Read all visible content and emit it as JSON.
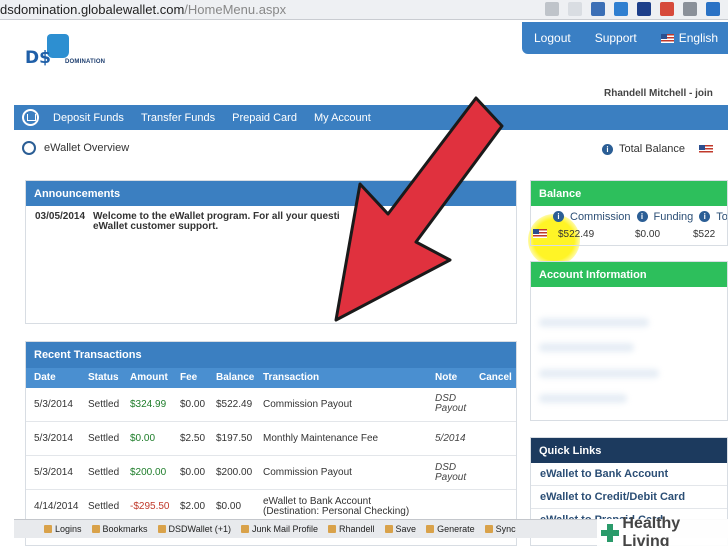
{
  "browser": {
    "url_domain": "dsdomination.globalewallet.com",
    "url_path": "/HomeMenu.aspx"
  },
  "brand": {
    "logo_text": "D$",
    "logo_sub": "DOMINATION"
  },
  "topnav": {
    "logout": "Logout",
    "support": "Support",
    "language": "English"
  },
  "user": {
    "name": "Rhandell Mitchell - join"
  },
  "mainnav": [
    "Deposit Funds",
    "Transfer Funds",
    "Prepaid Card",
    "My Account"
  ],
  "subheader": {
    "title": "eWallet Overview",
    "total_balance_label": "Total Balance"
  },
  "announcements": {
    "title": "Announcements",
    "items": [
      {
        "date": "03/05/2014",
        "text_line1": "Welcome to the eWallet program. For all your questi",
        "text_line2": "eWallet customer support."
      }
    ]
  },
  "transactions": {
    "title": "Recent Transactions",
    "columns": [
      "Date",
      "Status",
      "Amount",
      "Fee",
      "Balance",
      "Transaction",
      "Note",
      "Cancel"
    ],
    "rows": [
      {
        "date": "5/3/2014",
        "status": "Settled",
        "amount": "$324.99",
        "fee": "$0.00",
        "balance": "$522.49",
        "transaction": "Commission Payout",
        "transaction2": "",
        "note": "DSD Payout"
      },
      {
        "date": "5/3/2014",
        "status": "Settled",
        "amount": "$0.00",
        "fee": "$2.50",
        "balance": "$197.50",
        "transaction": "Monthly Maintenance Fee",
        "transaction2": "",
        "note": "5/2014"
      },
      {
        "date": "5/3/2014",
        "status": "Settled",
        "amount": "$200.00",
        "fee": "$0.00",
        "balance": "$200.00",
        "transaction": "Commission Payout",
        "transaction2": "",
        "note": "DSD Payout"
      },
      {
        "date": "4/14/2014",
        "status": "Settled",
        "amount": "-$295.50",
        "fee": "$2.00",
        "balance": "$0.00",
        "transaction": "eWallet to Bank Account",
        "transaction2": "(Destination: Personal Checking)",
        "note": ""
      }
    ]
  },
  "balance": {
    "title": "Balance",
    "headers": [
      "Commission",
      "Funding",
      "To"
    ],
    "values": [
      "$522.49",
      "$0.00",
      "$522"
    ]
  },
  "account_info": {
    "title": "Account Information"
  },
  "quick_links": {
    "title": "Quick Links",
    "items": [
      "eWallet to Bank Account",
      "eWallet to Credit/Debit Card",
      "eWallet to Prepaid Card"
    ]
  },
  "bookmarks": [
    "Logins",
    "Bookmarks",
    "DSDWallet (+1)",
    "Junk Mail Profile",
    "Rhandell",
    "Save",
    "Generate",
    "Sync"
  ],
  "watermark": {
    "text": "Healthy Living"
  },
  "colors": {
    "nav_blue": "#3b7fc1",
    "balance_green": "#2dbf5c",
    "arrow_red": "#e0313e",
    "highlight_yellow": "#fff200"
  }
}
